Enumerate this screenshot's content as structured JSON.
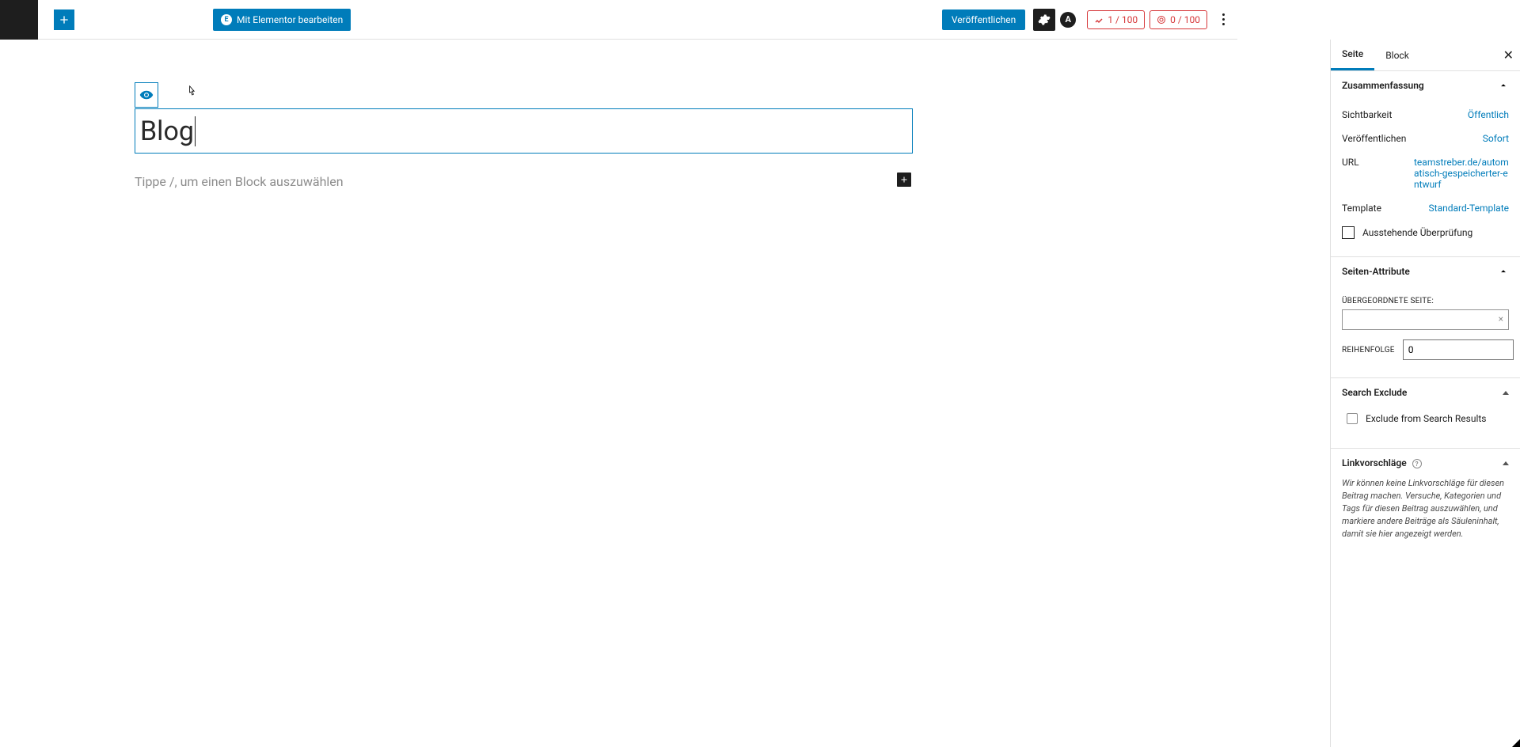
{
  "toolbar": {
    "elementor_label": "Mit Elementor bearbeiten",
    "publish_label": "Veröffentlichen",
    "astra_letter": "A",
    "score1": "1 / 100",
    "score2": "0 / 100"
  },
  "editor": {
    "title": "Blog",
    "block_prompt": "Tippe /, um einen Block auszuwählen"
  },
  "sidebar": {
    "tabs": {
      "page": "Seite",
      "block": "Block"
    },
    "summary": {
      "header": "Zusammenfassung",
      "visibility_label": "Sichtbarkeit",
      "visibility_value": "Öffentlich",
      "publish_label": "Veröffentlichen",
      "publish_value": "Sofort",
      "url_label": "URL",
      "url_value": "teamstreber.de/automatisch-gespeicherter-entwurf",
      "template_label": "Template",
      "template_value": "Standard-Template",
      "pending_label": "Ausstehende Überprüfung"
    },
    "page_attributes": {
      "header": "Seiten-Attribute",
      "parent_label": "ÜBERGEORDNETE SEITE:",
      "order_label": "REIHENFOLGE",
      "order_value": "0"
    },
    "search_exclude": {
      "header": "Search Exclude",
      "checkbox_label": "Exclude from Search Results"
    },
    "link_suggestions": {
      "header": "Linkvorschläge",
      "help": "?",
      "desc": "Wir können keine Linkvorschläge für diesen Beitrag machen. Versuche, Kategorien und Tags für diesen Beitrag auszuwählen, und markiere andere Beiträge als Säuleninhalt, damit sie hier angezeigt werden."
    }
  }
}
